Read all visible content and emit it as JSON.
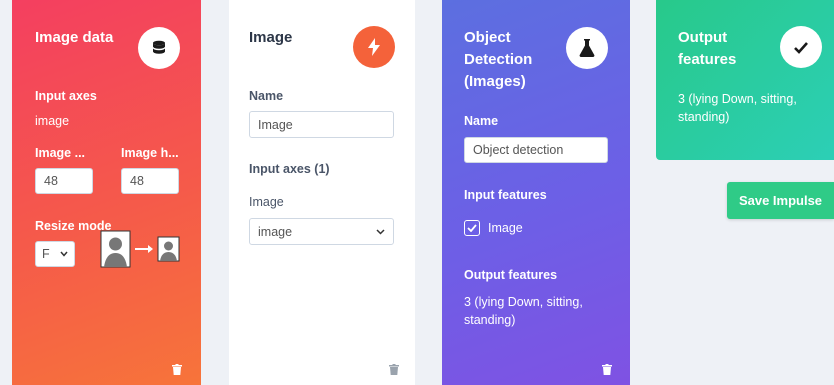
{
  "image_data_block": {
    "title": "Image data",
    "icon": "database-icon",
    "input_axes_label": "Input axes",
    "input_axes_value": "image",
    "width_label": "Image ...",
    "height_label": "Image h...",
    "width_value": "48",
    "height_value": "48",
    "resize_mode_label": "Resize mode",
    "resize_mode_value": "F"
  },
  "image_block": {
    "title": "Image",
    "icon": "bolt-icon",
    "name_label": "Name",
    "name_value": "Image",
    "input_axes_label": "Input axes (1)",
    "axis_label": "Image",
    "axis_value": "image"
  },
  "object_detection_block": {
    "title_line1": "Object",
    "title_line2": "Detection",
    "title_line3": "(Images)",
    "icon": "flask-icon",
    "name_label": "Name",
    "name_value": "Object detection",
    "input_features_label": "Input features",
    "input_feature_item": "Image",
    "output_features_label": "Output features",
    "output_features_line1": "3 (lying Down, sitting,",
    "output_features_line2": "standing)"
  },
  "output_features_block": {
    "title_line1": "Output",
    "title_line2": "features",
    "icon": "check-icon",
    "value_line1": "3 (lying Down, sitting,",
    "value_line2": "standing)"
  },
  "actions": {
    "save_label": "Save Impulse"
  },
  "colors": {
    "image_data_gradient": [
      "#f43f60",
      "#f7743a"
    ],
    "image_block_icon": "#f4623a",
    "object_detection_gradient": [
      "#5c6fe0",
      "#7f52e3"
    ],
    "output_gradient": [
      "#28c98a",
      "#2ccfb6"
    ],
    "save_button": "#2fcb87"
  }
}
